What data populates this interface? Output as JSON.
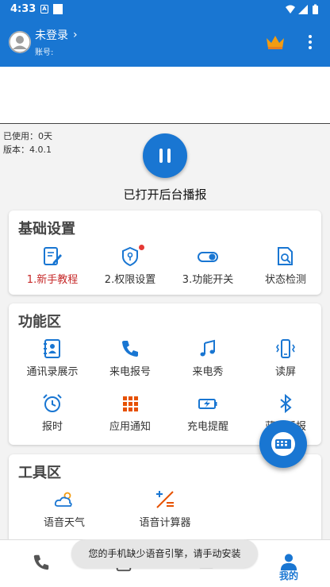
{
  "status_bar": {
    "time": "4:33",
    "notification_letter": "A"
  },
  "header": {
    "login_label": "未登录",
    "account_label": "账号:"
  },
  "usage": {
    "used": "已使用：0天",
    "version": "版本：4.0.1"
  },
  "broadcast": {
    "status": "已打开后台播报"
  },
  "basic_settings": {
    "title": "基础设置",
    "items": [
      {
        "label": "1.新手教程",
        "icon": "tutorial-icon"
      },
      {
        "label": "2.权限设置",
        "icon": "shield-key-icon"
      },
      {
        "label": "3.功能开关",
        "icon": "toggle-icon"
      },
      {
        "label": "状态检测",
        "icon": "document-search-icon"
      }
    ]
  },
  "features": {
    "title": "功能区",
    "items": [
      {
        "label": "通讯录展示",
        "icon": "contacts-icon"
      },
      {
        "label": "来电报号",
        "icon": "phone-icon"
      },
      {
        "label": "来电秀",
        "icon": "music-note-icon"
      },
      {
        "label": "读屏",
        "icon": "phone-vibrate-icon"
      },
      {
        "label": "报时",
        "icon": "alarm-clock-icon"
      },
      {
        "label": "应用通知",
        "icon": "apps-grid-icon"
      },
      {
        "label": "充电提醒",
        "icon": "battery-charging-icon"
      },
      {
        "label": "蓝牙播报",
        "icon": "bluetooth-icon"
      }
    ]
  },
  "tools": {
    "title": "工具区",
    "items": [
      {
        "label": "语音天气",
        "icon": "weather-icon"
      },
      {
        "label": "语音计算器",
        "icon": "calculator-icon"
      }
    ]
  },
  "bottom_nav": {
    "mine_label": "我的"
  },
  "toast": {
    "message": "您的手机缺少语音引擎，请手动安装"
  },
  "colors": {
    "primary": "#1976d2",
    "accent_red": "#c62828",
    "crown": "#f39c12"
  }
}
